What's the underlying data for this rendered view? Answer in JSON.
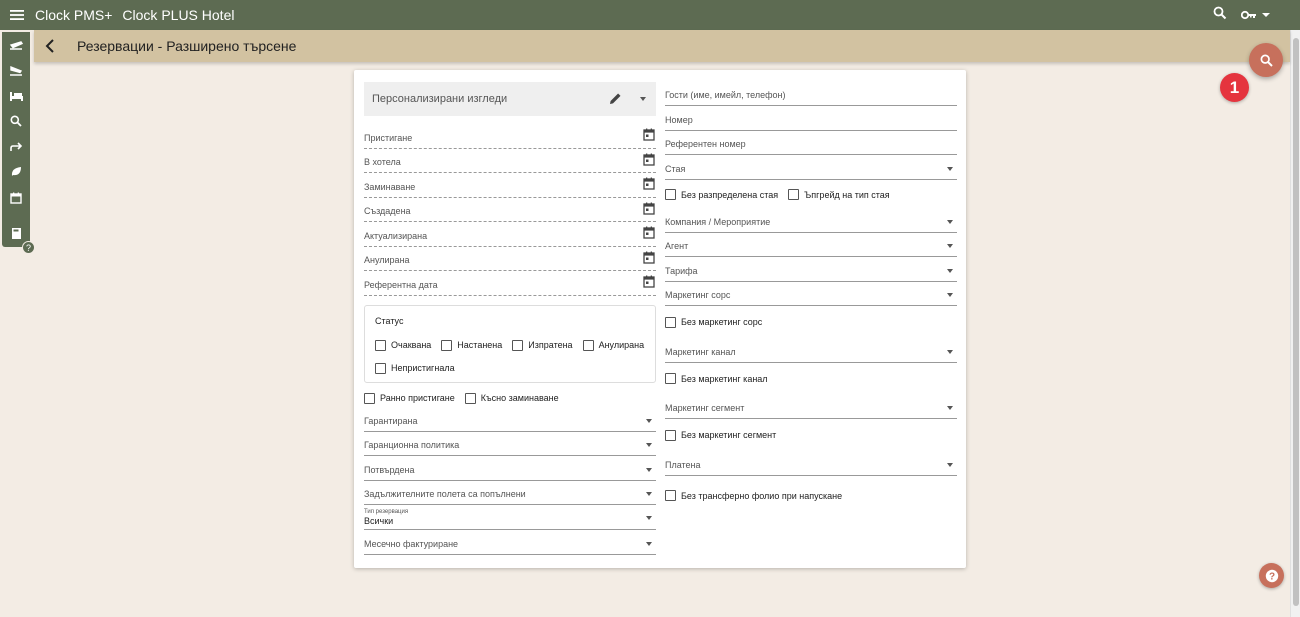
{
  "app": {
    "name": "Clock PMS+",
    "hotel": "Clock PLUS Hotel"
  },
  "header": {
    "title": "Резервации - Разширено търсене"
  },
  "badge": {
    "number": "1"
  },
  "sidebar": {
    "icons": [
      "departure-icon",
      "arrival-icon",
      "bed-icon",
      "search-icon",
      "forward-icon",
      "leaf-icon",
      "calendar-icon",
      "book-icon"
    ]
  },
  "left": {
    "custom_views": "Персонализирани изгледи",
    "dates": [
      "Пристигане",
      "В хотела",
      "Заминаване",
      "Създадена",
      "Актуализирана",
      "Анулирана",
      "Референтна дата"
    ],
    "status": {
      "label": "Статус",
      "options": [
        "Очаквана",
        "Настанена",
        "Изпратена",
        "Анулирана",
        "Непристигнала"
      ]
    },
    "early_arrival": "Ранно пристигане",
    "late_departure": "Късно заминаване",
    "selects1": [
      "Гарантирана",
      "Гаранционна политика",
      "Потвърдена",
      "Задължителните полета са попълнени"
    ],
    "reservation_type": {
      "label": "Тип резервация",
      "value": "Всички"
    },
    "monthly_billing": "Месечно фактуриране"
  },
  "right": {
    "guests": "Гости (име, имейл, телефон)",
    "number": "Номер",
    "reference_number": "Референтен номер",
    "room": "Стая",
    "no_assigned_room": "Без разпределена стая",
    "upgrade_room_type": "Ъпгрейд на тип стая",
    "company_event": "Компания / Мероприятие",
    "agent": "Агент",
    "rate": "Тарифа",
    "marketing_source": "Маркетинг сорс",
    "no_marketing_source": "Без маркетинг сорс",
    "marketing_channel": "Маркетинг канал",
    "no_marketing_channel": "Без маркетинг канал",
    "marketing_segment": "Маркетинг сегмент",
    "no_marketing_segment": "Без маркетинг сегмент",
    "paid": "Платена",
    "no_transfer_folio": "Без трансферно фолио при напускане"
  },
  "colors": {
    "topbar": "#5d6b52",
    "subheader": "#d2c2a1",
    "accent": "#c7705c",
    "badge": "#e5343e",
    "background": "#f3ece4"
  }
}
